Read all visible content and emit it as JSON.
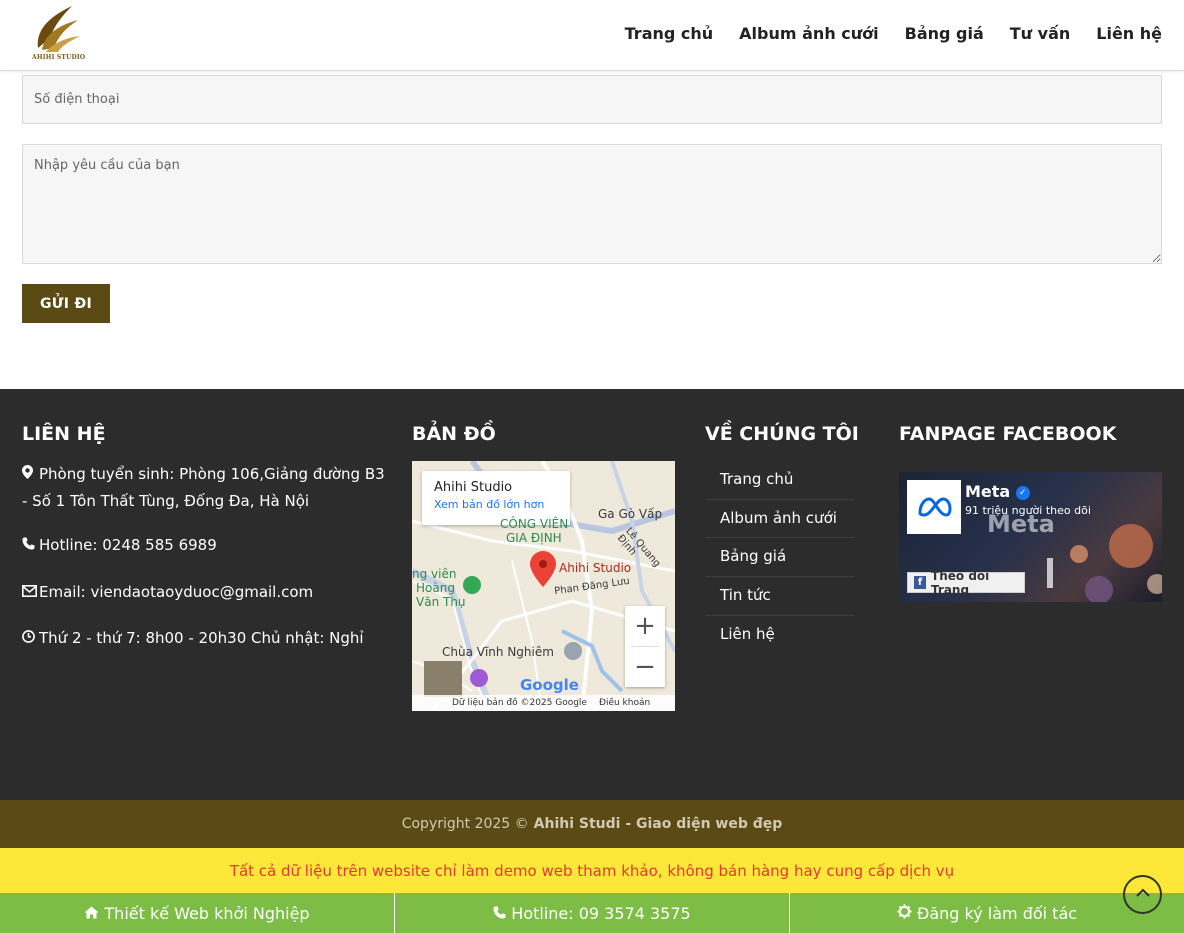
{
  "header": {
    "logo_text": "AHIHI STUDIO",
    "nav": [
      "Trang chủ",
      "Album ảnh cưới",
      "Bảng giá",
      "Tư vấn",
      "Liên hệ"
    ]
  },
  "form": {
    "phone_placeholder": "Số điện thoại",
    "request_placeholder": "Nhập yêu cầu của bạn",
    "submit_label": "GỬI ĐI"
  },
  "footer": {
    "contact": {
      "title": "LIÊN HỆ",
      "address": "Phòng tuyển sinh: Phòng 106,Giảng đường B3 - Số 1 Tôn Thất Tùng, Đống Đa, Hà Nội",
      "hotline": "Hotline: 0248 585 6989",
      "email": "Email: viendaotaoyduoc@gmail.com",
      "hours": "Thứ 2 - thứ 7: 8h00 - 20h30 Chủ nhật: Nghỉ"
    },
    "map": {
      "title": "BẢN ĐỒ",
      "place_name": "Ahihi Studio",
      "larger_map_link": "Xem bản đồ lớn hơn",
      "pin_label": "Ahihi Studio",
      "labels": [
        "CÔNG VIÊN",
        "GIA ĐỊNH",
        "Ga Gò Vấp",
        "Chùa Vĩnh Nghiêm",
        "Phan Đăng Lưu",
        "Lê Quang Định",
        "ng viên",
        "Hoàng",
        "Văn Thụ"
      ],
      "attribution": "Dữ liệu bản đồ ©2025 Google",
      "terms": "Điều khoản",
      "google_logo": "Google"
    },
    "about": {
      "title": "VỀ CHÚNG TÔI",
      "items": [
        "Trang chủ",
        "Album ảnh cưới",
        "Bảng giá",
        "Tin tức",
        "Liên hệ"
      ]
    },
    "facebook": {
      "title": "FANPAGE FACEBOOK",
      "page_name": "Meta",
      "followers": "91 triệu người theo dõi",
      "banner_text": "Meta",
      "follow_button": "Theo dõi Trang"
    }
  },
  "copyright": {
    "text": "Copyright 2025 ©",
    "brand": "Ahihi Studi - Giao diện web đẹp"
  },
  "notice": "Tất cả dữ liệu trên website chỉ làm demo web tham khảo, không bán hàng hay cung cấp dịch vụ",
  "bottom_bar": [
    "Thiết kế Web khởi Nghiệp",
    "Hotline: 09 3574 3575",
    "Đăng ký làm đối tác"
  ],
  "colors": {
    "brand_brown": "#5c4a14",
    "footer_bg": "#2c2c2c",
    "notice_bg": "#fde83a",
    "notice_text": "#e53935",
    "bottom_bar_bg": "#7dbd46"
  }
}
